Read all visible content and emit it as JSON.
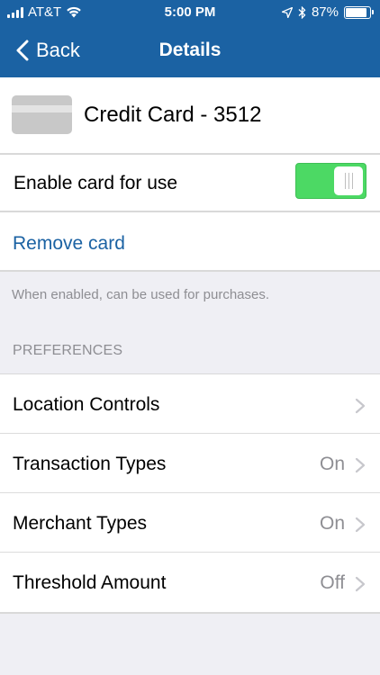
{
  "status_bar": {
    "carrier": "AT&T",
    "time": "5:00 PM",
    "battery": "87%",
    "battery_level": 0.87
  },
  "nav": {
    "back_label": "Back",
    "title": "Details"
  },
  "card": {
    "title": "Credit Card - 3512"
  },
  "toggle": {
    "label": "Enable card for use",
    "enabled": true
  },
  "remove_label": "Remove card",
  "hint": "When enabled, can be used for purchases.",
  "preferences": {
    "header": "PREFERENCES",
    "items": [
      {
        "label": "Location Controls",
        "value": ""
      },
      {
        "label": "Transaction Types",
        "value": "On"
      },
      {
        "label": "Merchant Types",
        "value": "On"
      },
      {
        "label": "Threshold Amount",
        "value": "Off"
      }
    ]
  },
  "colors": {
    "header_bg": "#1b62a3",
    "toggle_on": "#4cd964",
    "link": "#1b62a3",
    "secondary_text": "#8e8e93"
  }
}
